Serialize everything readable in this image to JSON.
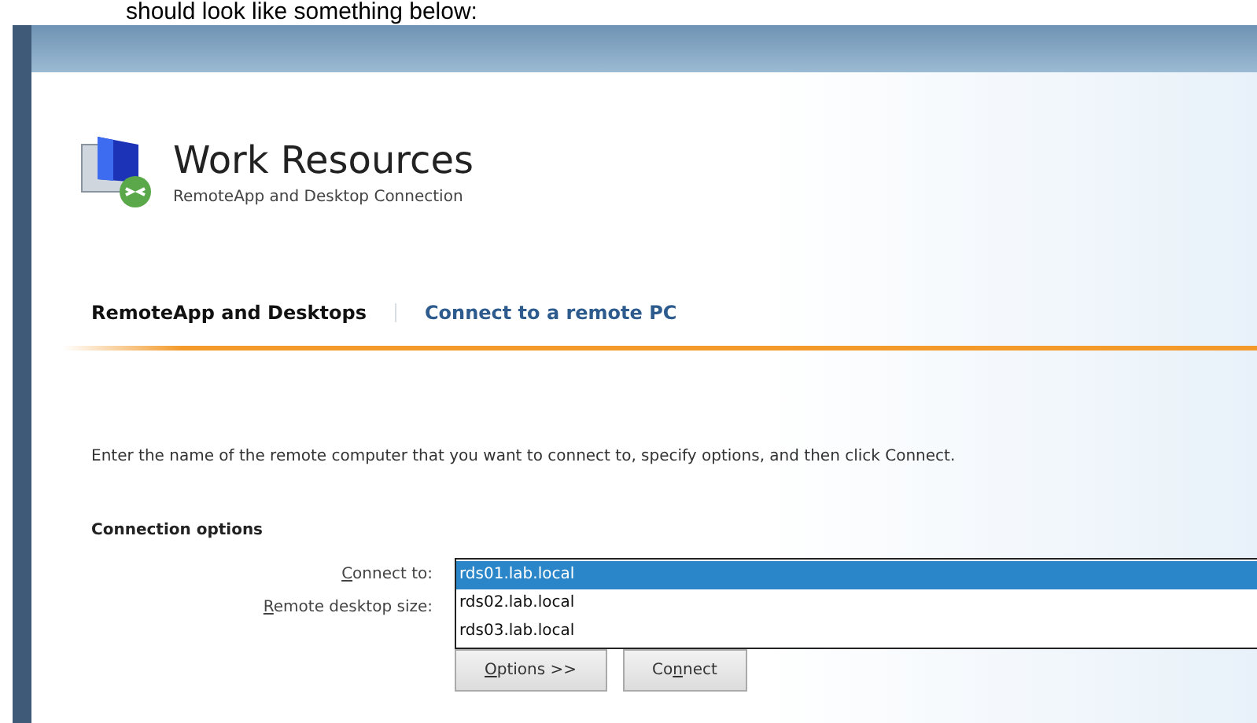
{
  "caption": "should look like something below:",
  "header": {
    "title": "Work Resources",
    "subtitle": "RemoteApp and Desktop Connection"
  },
  "tabs": [
    {
      "label": "RemoteApp and Desktops",
      "selected": true
    },
    {
      "label": "Connect to a remote PC",
      "selected": false
    }
  ],
  "instructions": "Enter the name of the remote computer that you want to connect to, specify options, and then click Connect.",
  "section_title": "Connection options",
  "fields": [
    {
      "key": "C",
      "after": "onnect to:"
    },
    {
      "key": "R",
      "after": "emote desktop size:"
    }
  ],
  "dropdown_options": [
    {
      "label": "rds01.lab.local",
      "selected": true
    },
    {
      "label": "rds02.lab.local",
      "selected": false
    },
    {
      "label": "rds03.lab.local",
      "selected": false
    }
  ],
  "buttons": [
    {
      "key": "O",
      "after": "ptions >>"
    },
    {
      "before": "Co",
      "key": "n",
      "after": "nect"
    }
  ]
}
